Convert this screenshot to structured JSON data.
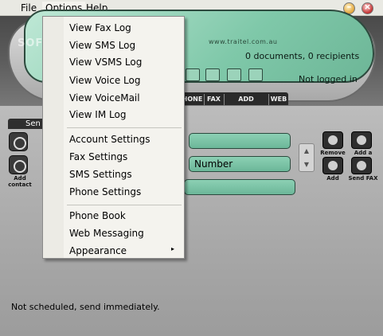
{
  "menubar": {
    "file": "File",
    "options": "Options",
    "help": "Help"
  },
  "window_controls": {
    "minimize_icon": "minimize-icon",
    "close_icon": "close-icon"
  },
  "watermark": "SOFTP",
  "display": {
    "site": "www.traitel.com.au",
    "documents": "0 documents, 0 recipients",
    "status": "Not logged in"
  },
  "buttonbar": {
    "phone": "HONE",
    "fax": "FAX",
    "add_credit": "ADD CREDIT",
    "web": "WEB"
  },
  "panel": {
    "tab_label": "Sen",
    "add_contact": "Add contact",
    "remove": "Remove",
    "add_page": "Add a page",
    "add": "Add",
    "send_fax": "Send FAX",
    "number_field": "Number",
    "schedule": "Not scheduled, send immediately."
  },
  "options_menu": {
    "items": [
      "View Fax Log",
      "View SMS Log",
      "View VSMS Log",
      "View Voice Log",
      "View VoiceMail",
      "View IM Log",
      "Account Settings",
      "Fax Settings",
      "SMS Settings",
      "Phone Settings",
      "Phone Book",
      "Web Messaging",
      "Appearance"
    ],
    "submenu_arrow": "▸"
  },
  "colors": {
    "display_green": "#7fc8a9",
    "field_green": "#6cb799",
    "menu_bg": "#f4f3ee"
  }
}
